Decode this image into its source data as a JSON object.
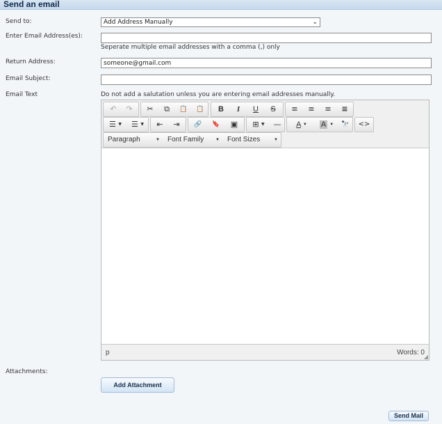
{
  "header": {
    "title": "Send an email"
  },
  "form": {
    "send_to_label": "Send to:",
    "send_to_value": "Add Address Manually",
    "emails_label": "Enter Email Address(es):",
    "emails_value": "",
    "emails_hint": "Seperate multiple email addresses with a comma (,) only",
    "return_label": "Return Address:",
    "return_value": "someone@gmail.com",
    "subject_label": "Email Subject:",
    "subject_value": "",
    "text_label": "Email Text",
    "text_hint": "Do not add a salutation unless you are entering email addresses manually.",
    "attachments_label": "Attachments:"
  },
  "editor": {
    "toolbar": {
      "undo_icon": "↶",
      "redo_icon": "↷",
      "cut_icon": "✂",
      "copy_icon": "⧉",
      "paste_icon": "📋",
      "paste_text_icon": "📋",
      "bold": "B",
      "italic": "I",
      "underline": "U",
      "strike": "S",
      "align_left_icon": "≡",
      "align_center_icon": "≡",
      "align_right_icon": "≡",
      "justify_icon": "≡",
      "bullet_list_icon": "☰",
      "numbered_list_icon": "☰",
      "outdent_icon": "⇤",
      "indent_icon": "⇥",
      "link_icon": "🔗",
      "bookmark_icon": "🔖",
      "image_icon": "▣",
      "table_icon": "⊞",
      "hr_icon": "—",
      "text_color_label": "A",
      "bg_color_label": "A",
      "find_icon": "🔭",
      "source_icon": "<>",
      "paragraph_dd": "Paragraph",
      "font_family_dd": "Font Family",
      "font_sizes_dd": "Font Sizes"
    },
    "status": {
      "path": "p",
      "words": "Words: 0"
    }
  },
  "buttons": {
    "add_attachment": "Add Attachment",
    "send_mail": "Send Mail"
  },
  "colors": {
    "header_bg": "#c7d9ec",
    "page_bg": "#f3f6f9",
    "button_bg": "#d3e4f5"
  }
}
